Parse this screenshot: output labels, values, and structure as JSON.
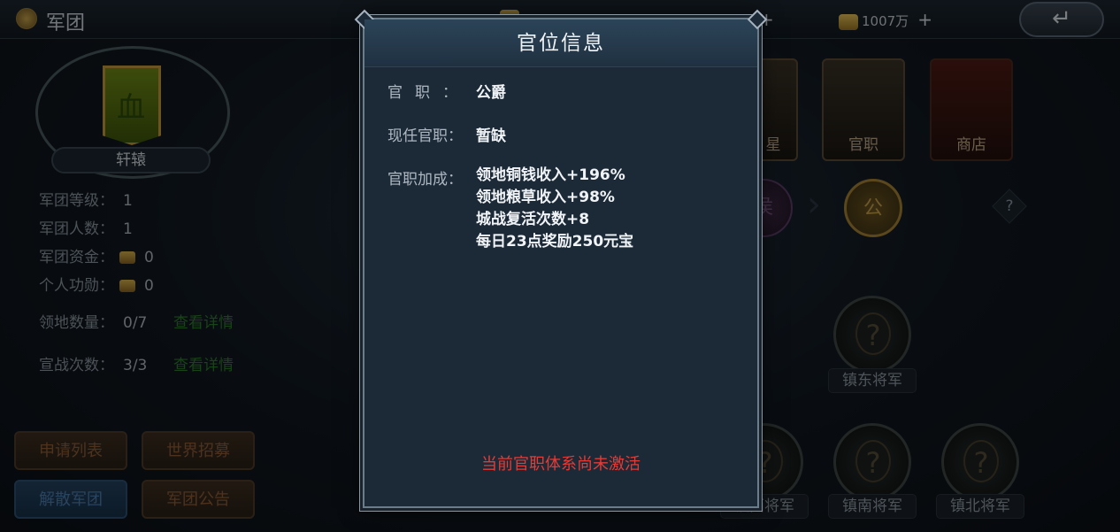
{
  "topbar": {
    "title": "军团",
    "gold": "1007万"
  },
  "left_panel": {
    "legion_name": "轩辕",
    "emblem_glyph": "血",
    "stats": [
      {
        "label": "军团等级：",
        "value": "1"
      },
      {
        "label": "军团人数：",
        "value": "1"
      },
      {
        "label": "军团资金：",
        "value": "0"
      },
      {
        "label": "个人功勋：",
        "value": "0"
      }
    ],
    "territory": {
      "label": "领地数量：",
      "value": "0/7",
      "link": "查看详情"
    },
    "war": {
      "label": "宣战次数：",
      "value": "3/3",
      "link": "查看详情"
    },
    "buttons": [
      "申请列表",
      "世界招募",
      "解散军团",
      "军团公告"
    ]
  },
  "right_panel": {
    "cards": [
      "星",
      "官职",
      "商店"
    ],
    "rank_gold": "公",
    "rank_purple": "侯",
    "help": "?",
    "generals": [
      {
        "label": "镇东将军",
        "icon": "?"
      },
      {
        "label": "镇西将军",
        "icon": "?"
      },
      {
        "label": "镇南将军",
        "icon": "?"
      },
      {
        "label": "镇北将军",
        "icon": "?"
      }
    ]
  },
  "dialog": {
    "title": "官位信息",
    "position_label": "官职：",
    "position_value": "公爵",
    "current_label": "现任官职：",
    "current_value": "暂缺",
    "bonus_label": "官职加成：",
    "bonuses": [
      "领地铜钱收入+196%",
      "领地粮草收入+98%",
      "城战复活次数+8",
      "每日23点奖励250元宝"
    ],
    "warning": "当前官职体系尚未激活",
    "warning_color": "#e43b36"
  }
}
